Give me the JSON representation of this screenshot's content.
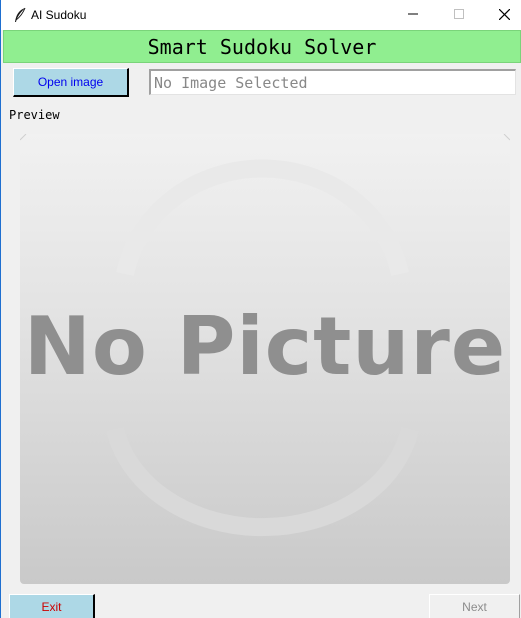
{
  "window": {
    "title": "AI Sudoku",
    "icon": "feather-icon",
    "controls": [
      "minimize-icon",
      "maximize-icon",
      "close-icon"
    ]
  },
  "header": {
    "title": "Smart Sudoku Solver",
    "background": "#90ee90"
  },
  "toolbar": {
    "open_label": "Open image",
    "open_color": "#add8e6",
    "path_placeholder": "No Image Selected",
    "path_value": ""
  },
  "preview": {
    "label": "Preview",
    "placeholder_text": "No Picture"
  },
  "footer": {
    "exit_label": "Exit",
    "exit_color": "#cc0000",
    "next_label": "Next",
    "next_enabled": false
  }
}
